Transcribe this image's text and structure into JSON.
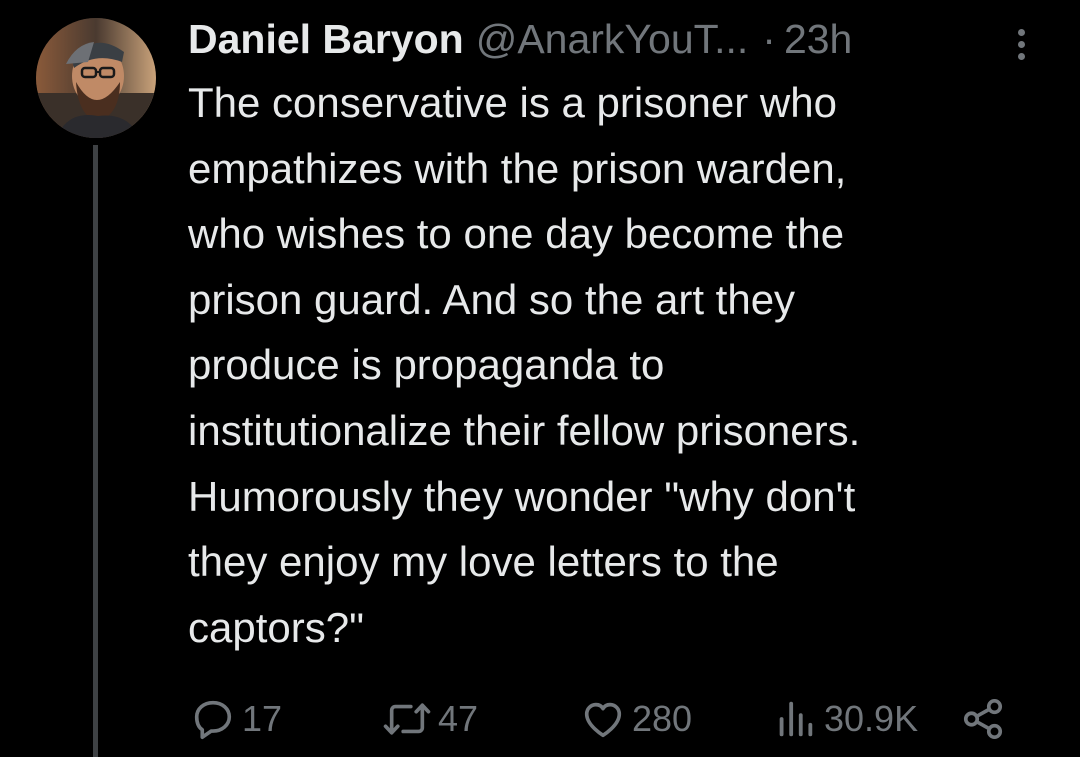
{
  "tweet": {
    "author": {
      "display_name": "Daniel Baryon",
      "handle": "@AnarkYouT...",
      "separator": "·",
      "timestamp": "23h"
    },
    "text_lines": [
      "The conservative is a prisoner who",
      "empathizes with the prison warden,",
      "who wishes to one day become the",
      "prison guard. And so the art they",
      "produce is propaganda to",
      "institutionalize their fellow prisoners.",
      "Humorously they wonder \"why don't",
      "they enjoy my love letters to the",
      "captors?\""
    ],
    "actions": {
      "reply_count": "17",
      "repost_count": "47",
      "like_count": "280",
      "view_count": "30.9K"
    },
    "icons": {
      "reply": "speech-bubble-icon",
      "repost": "repost-arrows-icon",
      "like": "heart-icon",
      "views": "bar-chart-icon",
      "share": "share-nodes-icon",
      "more": "vertical-ellipsis-icon"
    }
  },
  "colors": {
    "background": "#000000",
    "primary_text": "#e7e9ea",
    "secondary_text": "#71767b",
    "thread_line": "#3e4144"
  }
}
